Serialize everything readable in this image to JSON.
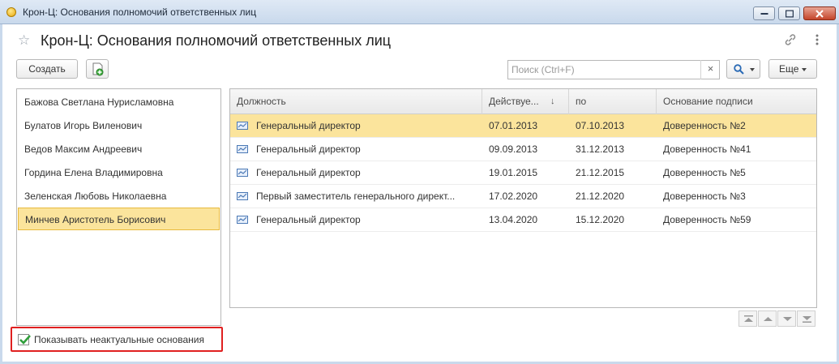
{
  "window": {
    "title": "Крон-Ц: Основания полномочий ответственных лиц"
  },
  "header": {
    "title": "Крон-Ц: Основания полномочий ответственных лиц"
  },
  "toolbar": {
    "create_label": "Создать",
    "search_placeholder": "Поиск (Ctrl+F)",
    "search_clear": "×",
    "more_label": "Еще"
  },
  "people": [
    "Бажова Светлана Нурисламовна",
    "Булатов Игорь Виленович",
    "Ведов Максим Андреевич",
    "Гордина Елена Владимировна",
    "Зеленская Любовь Николаевна",
    "Минчев Аристотель Борисович"
  ],
  "selected_person_index": 5,
  "table": {
    "columns": [
      "Должность",
      "Действуе...",
      "по",
      "Основание подписи"
    ],
    "sort_indicator": "↓",
    "rows": [
      {
        "position": "Генеральный директор",
        "from": "07.01.2013",
        "to": "07.10.2013",
        "basis": "Доверенность №2"
      },
      {
        "position": "Генеральный директор",
        "from": "09.09.2013",
        "to": "31.12.2013",
        "basis": "Доверенность №41"
      },
      {
        "position": "Генеральный директор",
        "from": "19.01.2015",
        "to": "21.12.2015",
        "basis": "Доверенность №5"
      },
      {
        "position": "Первый заместитель генерального директ...",
        "from": "17.02.2020",
        "to": "21.12.2020",
        "basis": "Доверенность №3"
      },
      {
        "position": "Генеральный директор",
        "from": "13.04.2020",
        "to": "15.12.2020",
        "basis": "Доверенность №59"
      }
    ],
    "selected_row_index": 0
  },
  "footer": {
    "show_inactive_label": "Показывать неактуальные основания",
    "show_inactive_checked": true
  },
  "colors": {
    "selection": "#fbe49c",
    "highlight_border": "#e02020",
    "checkbox_check": "#2f9e3a"
  }
}
